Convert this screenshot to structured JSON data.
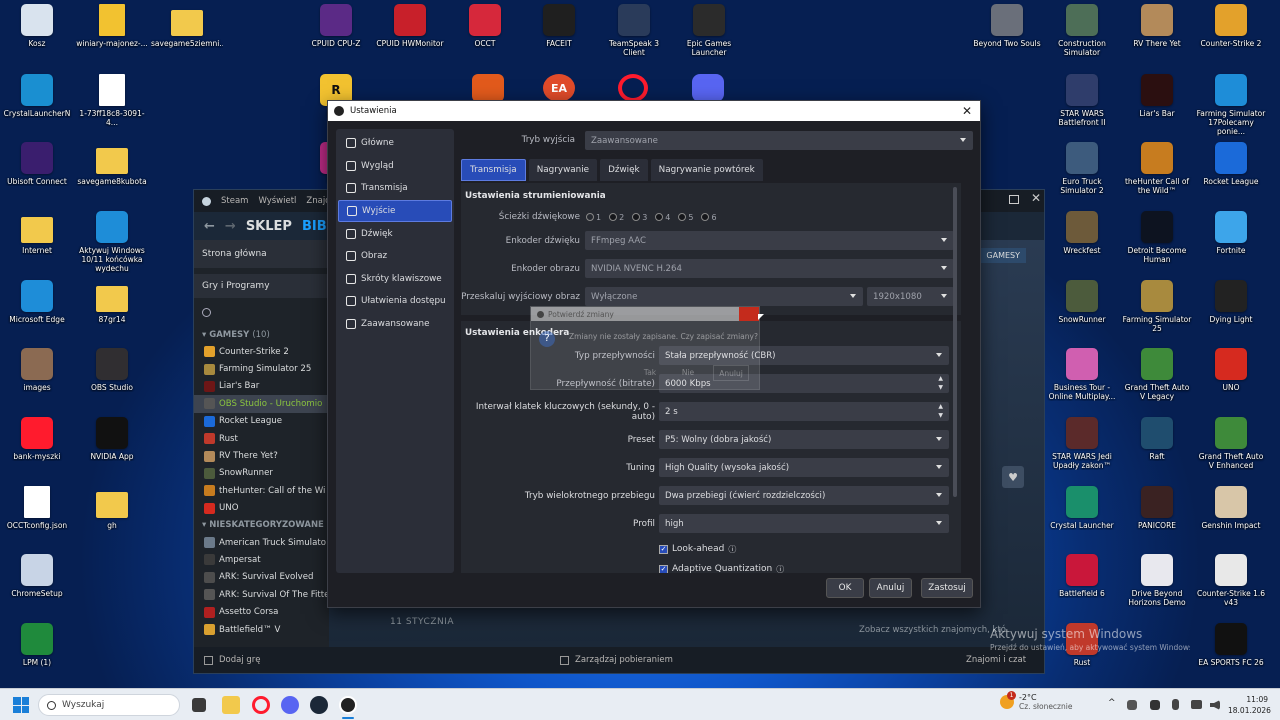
{
  "desktop_icons": [
    {
      "label": "Kosz",
      "icon": "recycle-bin-icon",
      "color": "#d9e3ee"
    },
    {
      "label": "winiary-majonez-...",
      "icon": "file-icon",
      "color": "#f2c230"
    },
    {
      "label": "savegame5ziemni...",
      "icon": "folder-icon",
      "color": "#f2c94c"
    },
    {
      "label": "CPUID CPU-Z",
      "icon": "cpuz-icon",
      "color": "#5b2a86"
    },
    {
      "label": "CPUID HWMonitor",
      "icon": "hwmonitor-icon",
      "color": "#c8202a"
    },
    {
      "label": "OCCT",
      "icon": "occt-icon",
      "color": "#d6283b"
    },
    {
      "label": "FACEIT",
      "icon": "faceit-icon",
      "color": "#1f1f1f"
    },
    {
      "label": "TeamSpeak 3 Client",
      "icon": "teamspeak-icon",
      "color": "#2a3b5a"
    },
    {
      "label": "Epic Games Launcher",
      "icon": "epic-icon",
      "color": "#2b2b2b"
    },
    {
      "label": "Beyond Two Souls",
      "icon": "game-icon",
      "color": "#6a6f7a"
    },
    {
      "label": "Construction Simulator",
      "icon": "game-icon",
      "color": "#4d6e57"
    },
    {
      "label": "RV There Yet",
      "icon": "game-icon",
      "color": "#b38a5a"
    },
    {
      "label": "Counter-Strike 2",
      "icon": "cs2-icon",
      "color": "#e3a12b"
    },
    {
      "label": "CrystalLauncherN",
      "icon": "crystal-icon",
      "color": "#1a8fd1"
    },
    {
      "label": "1-73ff18c8-3091-4...",
      "icon": "file-icon",
      "color": "#ffffff"
    },
    {
      "label": "STAR WARS Battlefront II",
      "icon": "game-icon",
      "color": "#2f3d6b"
    },
    {
      "label": "Liar's Bar",
      "icon": "game-icon",
      "color": "#2b0f10"
    },
    {
      "label": "Farming Simulator 17Polecamy ponie...",
      "icon": "edge-icon",
      "color": "#1e8dd8"
    },
    {
      "label": "Ubisoft Connect",
      "icon": "ubisoft-icon",
      "color": "#3a1e6e"
    },
    {
      "label": "savegame8kubota",
      "icon": "folder-icon",
      "color": "#f2c94c"
    },
    {
      "label": "Euro Truck Simulator 2",
      "icon": "game-icon",
      "color": "#3d5b7d"
    },
    {
      "label": "theHunter Call of the Wild™",
      "icon": "game-icon",
      "color": "#c77c1f"
    },
    {
      "label": "Rocket League",
      "icon": "rocket-icon",
      "color": "#1b6ad9"
    },
    {
      "label": "Internet",
      "icon": "folder-icon",
      "color": "#f2c94c"
    },
    {
      "label": "Aktywuj Windows 10/11 końcówka wydechu",
      "icon": "edge-icon",
      "color": "#1e8dd8"
    },
    {
      "label": "Wreckfest",
      "icon": "game-icon",
      "color": "#6d5a3a"
    },
    {
      "label": "Detroit Become Human",
      "icon": "game-icon",
      "color": "#0d1320"
    },
    {
      "label": "Fortnite",
      "icon": "game-icon",
      "color": "#3da5ea"
    },
    {
      "label": "Microsoft Edge",
      "icon": "edge-icon",
      "color": "#1e8dd8"
    },
    {
      "label": "87gr14",
      "icon": "folder-icon",
      "color": "#f2c94c"
    },
    {
      "label": "SnowRunner",
      "icon": "game-icon",
      "color": "#4c5b3c"
    },
    {
      "label": "Farming Simulator 25",
      "icon": "game-icon",
      "color": "#a88a3e"
    },
    {
      "label": "Dying Light",
      "icon": "game-icon",
      "color": "#222222"
    },
    {
      "label": "images",
      "icon": "image-icon",
      "color": "#8b6a52"
    },
    {
      "label": "OBS Studio",
      "icon": "obs-icon",
      "color": "#302e31"
    },
    {
      "label": "Business Tour - Online Multiplay...",
      "icon": "game-icon",
      "color": "#d05fb0"
    },
    {
      "label": "Grand Theft Auto V Legacy",
      "icon": "gta-icon",
      "color": "#3e8a3a"
    },
    {
      "label": "UNO",
      "icon": "uno-icon",
      "color": "#d62a1f"
    },
    {
      "label": "bank-myszki",
      "icon": "opera-icon",
      "color": "#ff1b2d"
    },
    {
      "label": "NVIDIA App",
      "icon": "nvidia-icon",
      "color": "#111111"
    },
    {
      "label": "STAR WARS Jedi Upadły zakon™",
      "icon": "game-icon",
      "color": "#5b2a2a"
    },
    {
      "label": "Raft",
      "icon": "game-icon",
      "color": "#1f4d6e"
    },
    {
      "label": "Grand Theft Auto V Enhanced",
      "icon": "gta-icon",
      "color": "#3e8a3a"
    },
    {
      "label": "OCCTconfig.json",
      "icon": "file-icon",
      "color": "#ffffff"
    },
    {
      "label": "gh",
      "icon": "folder-icon",
      "color": "#f2c94c"
    },
    {
      "label": "Crystal Launcher",
      "icon": "crystal-icon",
      "color": "#1a8f6b"
    },
    {
      "label": "PANICORE",
      "icon": "game-icon",
      "color": "#3a2222"
    },
    {
      "label": "Genshin Impact",
      "icon": "game-icon",
      "color": "#d8c6a8"
    },
    {
      "label": "ChromeSetup",
      "icon": "setup-icon",
      "color": "#c8d4e6"
    },
    {
      "label": "Battlefield 6",
      "icon": "game-icon",
      "color": "#c9173a"
    },
    {
      "label": "Drive Beyond Horizons Demo",
      "icon": "game-icon",
      "color": "#e8e8ee"
    },
    {
      "label": "Counter-Strike 1.6 v43",
      "icon": "cs-icon",
      "color": "#e8e8e8"
    },
    {
      "label": "LPM (1)",
      "icon": "excel-icon",
      "color": "#1f8a3c"
    },
    {
      "label": "Rust",
      "icon": "rust-icon",
      "color": "#c0392b"
    },
    {
      "label": "EA SPORTS FC 26",
      "icon": "fc26-icon",
      "color": "#111111"
    }
  ],
  "partial_icons": {
    "rockstar": "Rock",
    "majes": "Maje"
  },
  "steam": {
    "title": "Steam",
    "menu": [
      "Steam",
      "Wyświetl",
      "Znajomi"
    ],
    "nav_store": "SKLEP",
    "nav_library": "BIBLIO",
    "home": "Strona główna",
    "games_programs": "Gry i Programy",
    "group1_title": "GAMESY",
    "group1_count": "(10)",
    "games": [
      {
        "name": "Counter-Strike 2",
        "color": "#e3a12b"
      },
      {
        "name": "Farming Simulator 25",
        "color": "#a88a3e"
      },
      {
        "name": "Liar's Bar",
        "color": "#6d1616"
      },
      {
        "name": "OBS Studio - Uruchomio",
        "color": "#555555",
        "selected": true
      },
      {
        "name": "Rocket League",
        "color": "#1b6ad9"
      },
      {
        "name": "Rust",
        "color": "#c0392b"
      },
      {
        "name": "RV There Yet?",
        "color": "#b38a5a"
      },
      {
        "name": "SnowRunner",
        "color": "#4c5b3c"
      },
      {
        "name": "theHunter: Call of the Wi",
        "color": "#c77c1f"
      },
      {
        "name": "UNO",
        "color": "#d62a1f"
      }
    ],
    "group2_title": "NIESKATEGORYZOWANE",
    "group2_count": "(4",
    "uncat": [
      {
        "name": "American Truck Simulato",
        "color": "#6b7a8a"
      },
      {
        "name": "Ampersat",
        "color": "#3a3a3a"
      },
      {
        "name": "ARK: Survival Evolved",
        "color": "#4d4d4d"
      },
      {
        "name": "ARK: Survival Of The Fitte",
        "color": "#555555"
      },
      {
        "name": "Assetto Corsa",
        "color": "#b02020"
      },
      {
        "name": "Battlefield™ V",
        "color": "#d9a030"
      }
    ],
    "add_game": "Dodaj grę",
    "manage_downloads": "Zarządzaj pobieraniem",
    "friends_chat": "Znajomi i czat",
    "date_header": "11 STYCZNIA",
    "see_all_friends": "Zobacz wszystkich znajomych, któ",
    "gamesy_tag": "GAMESY"
  },
  "obs": {
    "title": "Ustawienia",
    "categories": [
      {
        "label": "Główne",
        "icon": "gear-icon"
      },
      {
        "label": "Wygląd",
        "icon": "appearance-icon"
      },
      {
        "label": "Transmisja",
        "icon": "stream-icon"
      },
      {
        "label": "Wyjście",
        "icon": "output-icon",
        "active": true
      },
      {
        "label": "Dźwięk",
        "icon": "speaker-icon"
      },
      {
        "label": "Obraz",
        "icon": "monitor-icon"
      },
      {
        "label": "Skróty klawiszowe",
        "icon": "keyboard-icon"
      },
      {
        "label": "Ułatwienia dostępu",
        "icon": "accessibility-icon"
      },
      {
        "label": "Zaawansowane",
        "icon": "wrench-icon"
      }
    ],
    "output_mode_label": "Tryb wyjścia",
    "output_mode_value": "Zaawansowane",
    "tabs": [
      "Transmisja",
      "Nagrywanie",
      "Dźwięk",
      "Nagrywanie powtórek"
    ],
    "active_tab": "Transmisja",
    "streaming_section": "Ustawienia strumieniowania",
    "audio_track_label": "Ścieżki dźwiękowe",
    "audio_tracks": [
      "1",
      "2",
      "3",
      "4",
      "5",
      "6"
    ],
    "audio_encoder_label": "Enkoder dźwięku",
    "audio_encoder_value": "FFmpeg AAC",
    "video_encoder_label": "Enkoder obrazu",
    "video_encoder_value": "NVIDIA NVENC H.264",
    "rescale_label": "Przeskaluj wyjściowy obraz",
    "rescale_value": "Wyłączone",
    "rescale_res": "1920x1080",
    "encoder_section": "Ustawienia enkodera",
    "rate_control_label": "Typ przepływności",
    "rate_control_value": "Stała przepływność (CBR)",
    "bitrate_label": "Przepływność (bitrate)",
    "bitrate_value": "6000 Kbps",
    "keyframe_label": "Interwał klatek kluczowych (sekundy, 0 - auto)",
    "keyframe_value": "2 s",
    "preset_label": "Preset",
    "preset_value": "P5: Wolny (dobra jakość)",
    "tuning_label": "Tuning",
    "tuning_value": "High Quality (wysoka jakość)",
    "multipass_label": "Tryb wielokrotnego przebiegu",
    "multipass_value": "Dwa przebiegi (ćwierć rozdzielczości)",
    "profile_label": "Profil",
    "profile_value": "high",
    "lookahead_label": "Look-ahead",
    "adaptive_label": "Adaptive Quantization",
    "ok": "OK",
    "cancel": "Anuluj",
    "apply": "Zastosuj"
  },
  "dialog": {
    "title": "Potwierdź zmiany",
    "message": "Zmiany nie zostały zapisane. Czy zapisać zmiany?",
    "yes": "Tak",
    "no": "Nie",
    "cancel": "Anuluj"
  },
  "watermark": {
    "line1": "Aktywuj system Windows",
    "line2": "Przejdź do ustawień, aby aktywować system Windows."
  },
  "taskbar": {
    "search_placeholder": "Wyszukaj",
    "weather_temp": "-2°C",
    "weather_desc": "Cz. słonecznie",
    "time": "11:09",
    "date": "18.01.2026",
    "notification_badge": "1"
  }
}
